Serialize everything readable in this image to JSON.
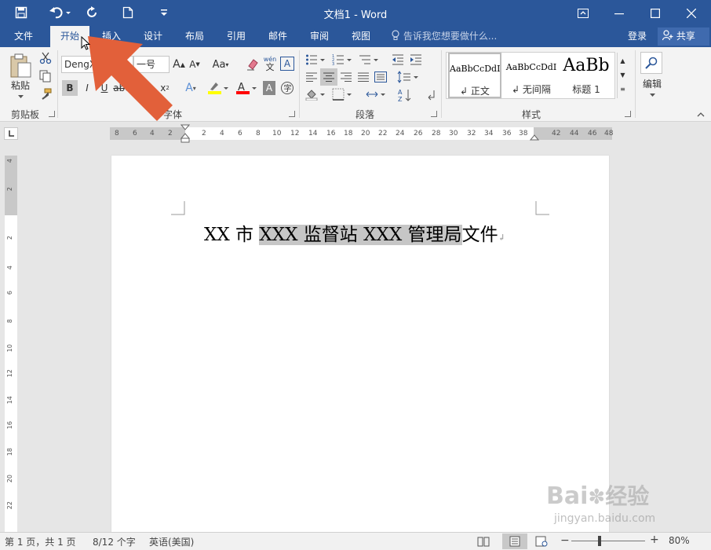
{
  "window": {
    "title": "文档1 - Word"
  },
  "tabs": [
    "文件",
    "开始",
    "插入",
    "设计",
    "布局",
    "引用",
    "邮件",
    "审阅",
    "视图"
  ],
  "tell_me": "告诉我您想要做什么...",
  "account": {
    "login": "登录",
    "share": "共享"
  },
  "ribbon": {
    "clipboard": {
      "label": "剪贴板",
      "paste": "粘贴"
    },
    "font": {
      "label": "字体",
      "font_name": "DengX",
      "font_size": "一号",
      "wen": "wén",
      "wen2": "文"
    },
    "paragraph": {
      "label": "段落"
    },
    "styles": {
      "label": "样式",
      "items": [
        {
          "sample": "AaBbCcDdI",
          "name": "正文"
        },
        {
          "sample": "AaBbCcDdI",
          "name": "无间隔"
        },
        {
          "sample": "AaBb",
          "name": "标题 1"
        }
      ]
    },
    "editing": {
      "label": "编辑"
    }
  },
  "ruler": {
    "h_ticks": [
      "8",
      "6",
      "4",
      "2",
      "2",
      "4",
      "6",
      "8",
      "10",
      "12",
      "14",
      "16",
      "18",
      "20",
      "22",
      "24",
      "26",
      "28",
      "30",
      "32",
      "34",
      "36",
      "38",
      "42",
      "44",
      "46",
      "48"
    ],
    "v_ticks": [
      "4",
      "2",
      "2",
      "4",
      "6",
      "8",
      "10",
      "12",
      "14",
      "16",
      "18",
      "20",
      "22"
    ]
  },
  "document": {
    "line_start": "XX 市 ",
    "line_selected": "XXX 监督站 XXX 管理局",
    "line_end": "文件"
  },
  "status": {
    "page": "第 1 页，共 1 页",
    "words": "8/12 个字",
    "language": "英语(美国)",
    "zoom": "80%"
  },
  "watermark": {
    "brand": "Bai",
    "brand2": "经验",
    "url": "jingyan.baidu.com"
  },
  "colors": {
    "titlebar": "#2b579a",
    "ribbon": "#f3f3f3",
    "arrow": "#e2603a",
    "selection": "#c6c6c6",
    "highlight": "#ffff00",
    "font_color": "#ff0000"
  }
}
